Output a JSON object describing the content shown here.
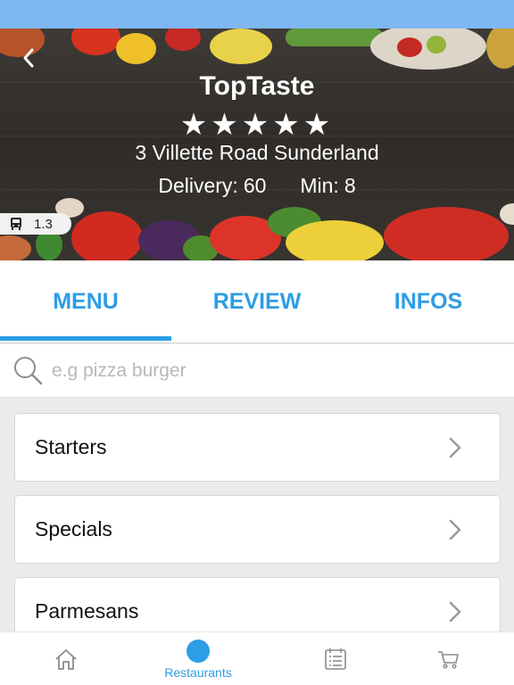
{
  "restaurant": {
    "name": "TopTaste",
    "rating_stars": "★★★★★",
    "rating": 5,
    "address": "3 Villette Road Sunderland",
    "delivery_label": "Delivery:",
    "delivery_value": "60",
    "min_label": "Min:",
    "min_value": "8",
    "distance": "1.3"
  },
  "tabs": [
    {
      "label": "MENU",
      "active": true
    },
    {
      "label": "REVIEW",
      "active": false
    },
    {
      "label": "INFOS",
      "active": false
    }
  ],
  "search": {
    "placeholder": "e.g pizza burger",
    "value": ""
  },
  "categories": [
    {
      "label": "Starters"
    },
    {
      "label": "Specials"
    },
    {
      "label": "Parmesans"
    }
  ],
  "bottom_nav": [
    {
      "icon": "home-icon",
      "label": ""
    },
    {
      "icon": "restaurants-icon",
      "label": "Restaurants",
      "active": true
    },
    {
      "icon": "orders-list-icon",
      "label": ""
    },
    {
      "icon": "cart-icon",
      "label": ""
    }
  ],
  "colors": {
    "accent": "#2c9de6",
    "status_bar": "#7fb7f2",
    "hero_bg": "#3e3a36"
  }
}
